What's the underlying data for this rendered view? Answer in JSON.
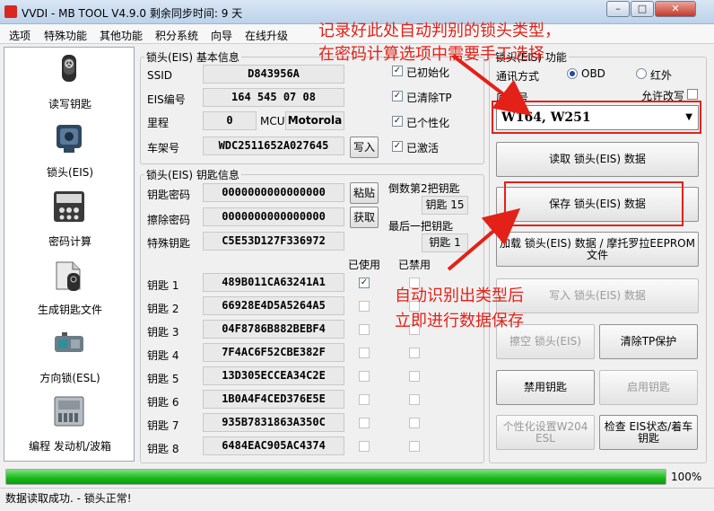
{
  "window": {
    "title": "VVDI - MB TOOL V4.9.0   剩余同步时间: 9 天",
    "min": "–",
    "max": "□",
    "close": "✕"
  },
  "menu": [
    "选项",
    "特殊功能",
    "其他功能",
    "积分系统",
    "向导",
    "在线升级"
  ],
  "sidebar": [
    {
      "label": "读写钥匙",
      "icon": "car-key-icon"
    },
    {
      "label": "锁头(EIS)",
      "icon": "ignition-lock-icon"
    },
    {
      "label": "密码计算",
      "icon": "password-calc-icon"
    },
    {
      "label": "生成钥匙文件",
      "icon": "key-file-icon"
    },
    {
      "label": "方向锁(ESL)",
      "icon": "steering-lock-icon"
    },
    {
      "label": "编程 发动机/波箱",
      "icon": "ecu-module-icon"
    }
  ],
  "eis_basic": {
    "legend": "锁头(EIS) 基本信息",
    "ssid_label": "SSID",
    "ssid": "D843956A",
    "eis_no_label": "EIS编号",
    "eis_no": "164 545 07 08",
    "mileage_label": "里程",
    "mileage": "0",
    "mcu_label": "MCU",
    "mcu": "Motorola",
    "vin_label": "车架号",
    "vin": "WDC2511652A027645",
    "write_btn": "写入",
    "flags": [
      {
        "label": "已初始化",
        "checked": true
      },
      {
        "label": "已清除TP",
        "checked": true
      },
      {
        "label": "已个性化",
        "checked": true
      },
      {
        "label": "已激活",
        "checked": true
      }
    ]
  },
  "eis_keys": {
    "legend": "锁头(EIS) 钥匙信息",
    "key_pwd_label": "钥匙密码",
    "key_pwd": "0000000000000000",
    "paste_btn": "粘贴",
    "erase_pwd_label": "擦除密码",
    "erase_pwd": "0000000000000000",
    "get_btn": "获取",
    "special_label": "特殊钥匙",
    "special": "C5E53D127F336972",
    "second_last_label": "倒数第2把钥匙",
    "second_last_value": "钥匙 15",
    "last_label": "最后一把钥匙",
    "last_value": "钥匙 1",
    "used_header": "已使用",
    "disabled_header": "已禁用",
    "keys": [
      {
        "label": "钥匙 1",
        "value": "489B011CA63241A1",
        "used": true
      },
      {
        "label": "钥匙 2",
        "value": "66928E4D5A5264A5",
        "used": false
      },
      {
        "label": "钥匙 3",
        "value": "04F8786B882BEBF4",
        "used": false
      },
      {
        "label": "钥匙 4",
        "value": "7F4AC6F52CBE382F",
        "used": false
      },
      {
        "label": "钥匙 5",
        "value": "13D305ECCEA34C2E",
        "used": false
      },
      {
        "label": "钥匙 6",
        "value": "1B0A4F4CED376E5E",
        "used": false
      },
      {
        "label": "钥匙 7",
        "value": "935B7831863A350C",
        "used": false
      },
      {
        "label": "钥匙 8",
        "value": "6484EAC905AC4374",
        "used": false
      }
    ]
  },
  "right_panel": {
    "legend": "锁头(EIS) 功能",
    "comm_label": "通讯方式",
    "obd": "OBD",
    "ir": "红外",
    "chassis_label": "底盘号",
    "allow_edit": "允许改写",
    "chassis": "W164, W251",
    "read_btn": "读取 锁头(EIS) 数据",
    "save_btn": "保存 锁头(EIS) 数据",
    "load_btn": "加载 锁头(EIS) 数据 / 摩托罗拉EEPROM 文件",
    "write_btn": "写入 锁头(EIS) 数据",
    "erase_btn": "擦空 锁头(EIS)",
    "clear_tp_btn": "清除TP保护",
    "disable_key_btn": "禁用钥匙",
    "enable_key_btn": "启用钥匙",
    "personalize_btn": "个性化设置W204 ESL",
    "check_btn": "检查 EIS状态/着车钥匙"
  },
  "annotations": {
    "top1": "记录好此处自动判别的锁头类型，",
    "top2": "在密码计算选项中需要手工选择",
    "mid1": "自动识别出类型后",
    "mid2": "立即进行数据保存"
  },
  "progress": {
    "value": 1.0,
    "label": "100%"
  },
  "status": "数据读取成功. - 锁头正常!",
  "colors": {
    "annotation": "#e32118",
    "progress": "#17b817"
  }
}
